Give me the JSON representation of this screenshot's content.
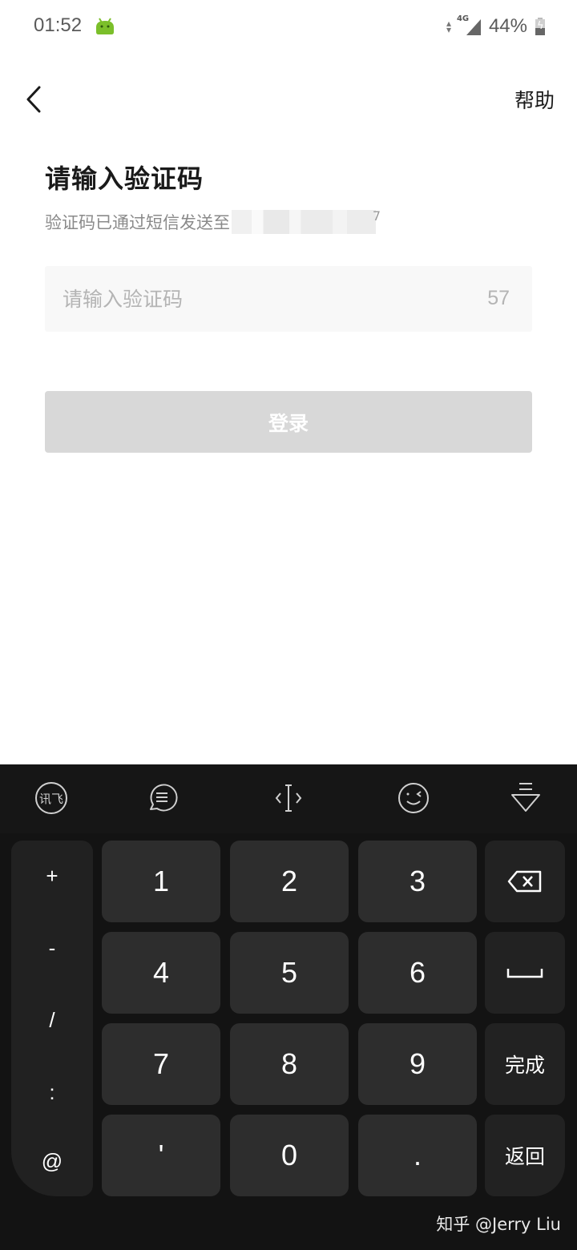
{
  "status_bar": {
    "time": "01:52",
    "network": "4G",
    "battery_percent_label": "44%",
    "battery_level": 0.44,
    "icons": [
      "android-debug-icon",
      "data-arrows-icon",
      "signal-icon",
      "battery-charging-icon"
    ]
  },
  "header": {
    "back_icon": "chevron-left-icon",
    "help_label": "帮助"
  },
  "main": {
    "title": "请输入验证码",
    "subtitle": "验证码已通过短信发送至",
    "phone_masked_tail": "7",
    "code_input": {
      "value": "",
      "placeholder": "请输入验证码"
    },
    "countdown": "57",
    "login_label": "登录",
    "colors": {
      "title": "#1a1a1a",
      "subtitle": "#8a8a8a",
      "input_bg": "#f8f8f8",
      "login_disabled_bg": "#d8d8d8"
    }
  },
  "keyboard": {
    "toolbar": [
      {
        "name": "iflytek-logo-icon",
        "label": "讯飞"
      },
      {
        "name": "phrases-icon",
        "label": ""
      },
      {
        "name": "cursor-move-icon",
        "label": ""
      },
      {
        "name": "emoji-icon",
        "label": ""
      },
      {
        "name": "hide-keyboard-icon",
        "label": ""
      }
    ],
    "side_symbols": [
      "+",
      "-",
      "/",
      ":",
      "@"
    ],
    "number_rows": [
      [
        "1",
        "2",
        "3"
      ],
      [
        "4",
        "5",
        "6"
      ],
      [
        "7",
        "8",
        "9"
      ],
      [
        "'",
        "0",
        "."
      ]
    ],
    "function_keys": {
      "backspace_icon": "backspace-icon",
      "space_icon": "space-icon",
      "done_label": "完成",
      "back_label": "返回"
    },
    "colors": {
      "background": "#131313",
      "key": "#2d2d2d",
      "function_key": "#222222",
      "key_text": "#ffffff"
    }
  },
  "watermark": "知乎 @Jerry Liu"
}
